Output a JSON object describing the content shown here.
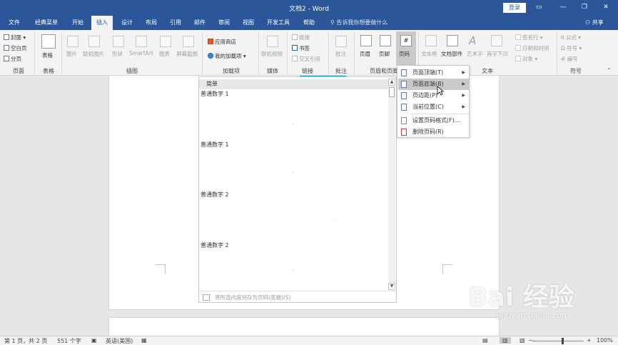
{
  "window": {
    "title": "文档2 - Word",
    "login": "登录",
    "minimize": "—",
    "restore": "❐",
    "close": "✕",
    "ribbon_display": "▭"
  },
  "tabs": [
    "文件",
    "经典菜单",
    "开始",
    "插入",
    "设计",
    "布局",
    "引用",
    "邮件",
    "审阅",
    "视图",
    "开发工具",
    "帮助"
  ],
  "tellme": "告诉我你想要做什么",
  "share": "共享",
  "ribbon": {
    "groups": [
      "页面",
      "表格",
      "插图",
      "加载项",
      "媒体",
      "链接",
      "批注",
      "页眉和页脚",
      "文本",
      "符号"
    ],
    "pages": {
      "cover": "封面",
      "blank": "空白页",
      "break": "分页"
    },
    "table": "表格",
    "illus": [
      "图片",
      "联机图片",
      "形状",
      "SmartArt",
      "图表",
      "屏幕截图"
    ],
    "addins": {
      "store": "应用商店",
      "my": "我的加载项"
    },
    "media": "联机视频",
    "links": {
      "link": "链接",
      "bookmark": "书签",
      "crossref": "交叉引用"
    },
    "comment": "批注",
    "hf": {
      "header": "页眉",
      "footer": "页脚",
      "pagenum": "页码"
    },
    "text": [
      "文本框",
      "文档部件",
      "艺术字",
      "首字下沉"
    ],
    "text_small": [
      "签名行",
      "日期和时间",
      "对象"
    ],
    "symbols": {
      "eq": "公式",
      "sym": "符号",
      "num": "编号"
    }
  },
  "gallery": {
    "header": "简单",
    "items": [
      "普通数字 1",
      "普通数字 1",
      "普通数字 2",
      "普通数字 2"
    ],
    "footer": "将所选内容另存为页码(底端)(S)"
  },
  "menu": {
    "items": [
      "页面顶端(T)",
      "页面底端(B)",
      "页边距(P)",
      "当前位置(C)",
      "设置页码格式(F)...",
      "删除页码(R)"
    ]
  },
  "status": {
    "page": "第 1 页，共 2 页",
    "words": "551 个字",
    "lang": "英语(美国)",
    "zoom": "100%",
    "zoom_minus": "−",
    "zoom_plus": "+"
  },
  "watermark": {
    "brand": "Bai 经验",
    "url": "jingyan.baidu.com"
  },
  "colors": {
    "accent": "#2b579a"
  }
}
